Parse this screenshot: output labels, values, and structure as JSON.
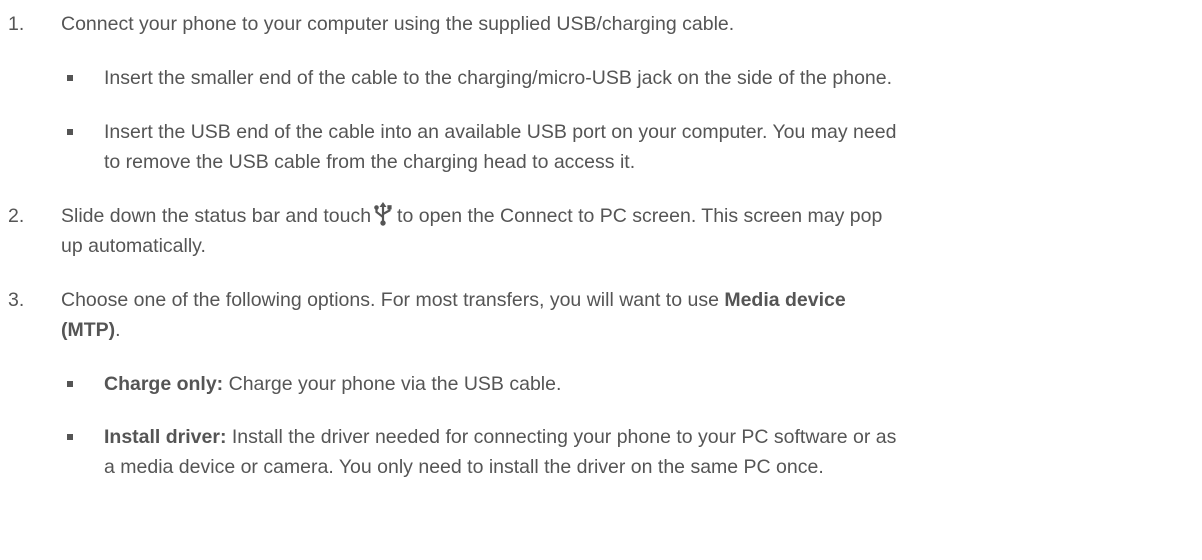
{
  "steps": [
    {
      "number": "1.",
      "text": "Connect your phone to your computer using the supplied USB/charging cable.",
      "bullets": [
        {
          "text": "Insert the smaller end of the cable to the charging/micro-USB jack on the side of the phone."
        },
        {
          "text_line1": "Insert the USB end of the cable into an available USB port on your computer. You may need",
          "text_line2": "to remove the USB cable from the charging head to access it."
        }
      ]
    },
    {
      "number": "2.",
      "text_before_icon": "Slide down the status bar and touch",
      "icon": "usb-icon",
      "text_after_icon": "to open the Connect to PC screen. This screen may pop",
      "text_line2": "up automatically."
    },
    {
      "number": "3.",
      "text_line1": "Choose one of the following options. For most transfers, you will want to use",
      "bold_line1": "Media device",
      "bold_line2": "(MTP)",
      "after_bold": ".",
      "bullets": [
        {
          "label": "Charge only:",
          "text": "Charge your phone via the USB cable."
        },
        {
          "label": "Install driver:",
          "text_line1": "Install the driver needed for connecting your phone to your PC software or as",
          "text_line2": "a media device or camera. You only need to install the driver on the same PC once."
        }
      ]
    }
  ]
}
